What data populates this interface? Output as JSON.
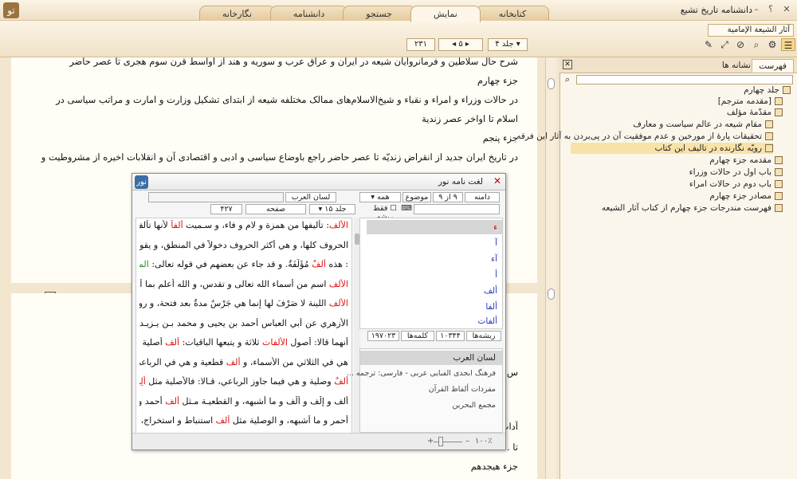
{
  "app": {
    "title": "دانشنامه تاریخ تشیع",
    "help_label": "؟",
    "minimize_label": "–",
    "logo_text": "تو"
  },
  "tabs": [
    {
      "label": "کتابخانه"
    },
    {
      "label": "نمایش"
    },
    {
      "label": "جستجو"
    },
    {
      "label": "دانشنامه"
    },
    {
      "label": "نگارخانه"
    }
  ],
  "toolbar": {
    "book_title": "آثار الشیعة الإمامیة",
    "volume_label": "جلد",
    "volume_value": "۴",
    "page_value": "۵",
    "page_total": "۲۳۱",
    "icons": [
      "list-icon",
      "gear-icon",
      "search-icon",
      "tag-icon",
      "expand-icon",
      "tools-icon"
    ]
  },
  "document": {
    "lines_page1": [
      "شرح حال سلاطین و فرمانروایان شیعه در ایران و عراق عرب و سوریه و هند از اواسط قرن سوم هجری تا عصر حاضر",
      "جزء چهارم",
      "در حالات وزراء و امراء و نقباء و شیخ‌الاسلام‌های ممالک مختلفه شیعه از ابتدای تشکیل وزارت و امارت و مراتب سیاسی در",
      "اسلام تا اواخر عصر زندیة",
      "جزء پنجم",
      "در تاریخ ایران جدید از انقراض زندیّه تا عصر حاضر راجع باوضاع سیاسی و ادبی و اقتصادی آن و انقلابات اخیره از مشروطیت و"
    ],
    "lines_page2": [
      "س از فهرس‌های مفصل",
      "آداب اللغة العربیته تالیف",
      "تا ...",
      "جزء هیجدهم"
    ]
  },
  "right_panel": {
    "tabs": [
      {
        "label": "فهرست"
      },
      {
        "label": "نشانه ها"
      }
    ],
    "toc": [
      {
        "label": "جلد چهارم",
        "level": 0
      },
      {
        "label": "[مقدمه مترجم]",
        "level": 1
      },
      {
        "label": "مقدّمهٔ مؤلف",
        "level": 1
      },
      {
        "label": "مقام شیعه در عالم سیاست و معارف",
        "level": 2
      },
      {
        "label": "تحقیقات پارهٔ از مورخین و عدم موفقیت آن در پی‌بردن به آثار این فرقه",
        "level": 2
      },
      {
        "label": "رویّه نگارنده در تالیف این کتاب",
        "level": 2,
        "selected": true
      },
      {
        "label": "مقدمه جزء چهارم",
        "level": 1
      },
      {
        "label": "باب اول در حالات وزراء",
        "level": 1
      },
      {
        "label": "باب دوم در حالات امراء",
        "level": 1
      },
      {
        "label": "مصادر جزء چهارم",
        "level": 1
      },
      {
        "label": "فهرست مندرجات جزء چهارم از کتاب آثار الشیعه",
        "level": 1
      }
    ]
  },
  "dialog": {
    "title": "لغت نامه نور",
    "search_scope": "دامنه",
    "range_text": "۹ از ۹",
    "topic_label": "موضوع",
    "topic_value": "همه",
    "root_only_label": "فقط ریشه",
    "dict_name": "لسان العرب",
    "volume_label": "جلد",
    "volume_value": "۱۵",
    "page_label": "صفحه",
    "page_value": "۴۲۷",
    "roots_label": "ریشه‌ها",
    "roots_count": "۱۰۳۴۴",
    "words_label": "کلمه‌ها",
    "words_count": "۱۹۷۰۲۳",
    "zoom_label": "۱۰۰٪",
    "words": [
      {
        "label": "ء",
        "selected": true
      },
      {
        "label": "آ"
      },
      {
        "label": "آء"
      },
      {
        "label": "أ"
      },
      {
        "label": "ألف"
      },
      {
        "label": "ألفا"
      },
      {
        "label": "ألفات"
      }
    ],
    "dictionaries": [
      {
        "label": "لسان العرب",
        "selected": true
      },
      {
        "label": "فرهنگ ابجدی الفبایی عربی - فارسی: ترجمه ..."
      },
      {
        "label": "مفردات ألفاظ القرآن"
      },
      {
        "label": "مجمع البحرين"
      }
    ]
  },
  "entry_text": [
    [
      {
        "t": "الأَلف",
        "c": "r"
      },
      {
        "t": ": تأليفها من همزة و لام و فاء، و سـميت "
      },
      {
        "t": "أَلفاً",
        "c": "r"
      },
      {
        "t": " لأَنها تأْلف"
      }
    ],
    [
      {
        "t": "الحروف كلها، و هي أَكثر الحروف دخولاً في المنطق، و يقولون"
      }
    ],
    [
      {
        "t": ": هذه "
      },
      {
        "t": "أَلفٌ",
        "c": "r"
      },
      {
        "t": " مُؤَلَّفَةٌ. و قد جاء عن بعضهم في قوله تعالى: "
      },
      {
        "t": "الم",
        "c": "g"
      },
      {
        "t": " أَن"
      }
    ],
    [
      {
        "t": "الأَلف",
        "c": "r"
      },
      {
        "t": " اسم من أَسماء الله تعالى و تقدس، و الله أَعلم بما أَراد، و"
      }
    ],
    [
      {
        "t": "الأَلف",
        "c": "r"
      },
      {
        "t": " اللينة لا صَرْفَ لها إِنما هي جَرْسٌ مدةٌ بعد فتحة، و روى"
      }
    ],
    [
      {
        "t": "الأَزهري عن أَبي العباس أَحمد بن يحيى و محمد بـن يـزيـد"
      }
    ],
    [
      {
        "t": "أَنهما قالا: أُصول "
      },
      {
        "t": "الأَلفات",
        "c": "r"
      },
      {
        "t": " ثلاثة و يتبعها الباقيات: "
      },
      {
        "t": "أَلف",
        "c": "r"
      },
      {
        "t": " أَصلية و"
      }
    ],
    [
      {
        "t": "هي في الثلاثي من الأَسماء، و "
      },
      {
        "t": "أَلف",
        "c": "r"
      },
      {
        "t": " قطعية و هي في الرباعي، و"
      }
    ],
    [
      {
        "t": "أَلفٌ",
        "c": "r"
      },
      {
        "t": " وصلية و هي فيما جاوز الرباعي، قـالا: فالأَصلية مثل "
      },
      {
        "t": "أَلِف",
        "c": "r"
      }
    ],
    [
      {
        "t": "أَلف و إِلْف و أَلْف و ما أَشبهه، و القطعيـة مـثل "
      },
      {
        "t": "أَلف",
        "c": "r"
      },
      {
        "t": " أَحمد و"
      }
    ],
    [
      {
        "t": "أَحمر و ما أَشبهه، و الوصلية مثل "
      },
      {
        "t": "أَلف",
        "c": "r"
      },
      {
        "t": " استنباط و استخراج، و"
      }
    ]
  ]
}
